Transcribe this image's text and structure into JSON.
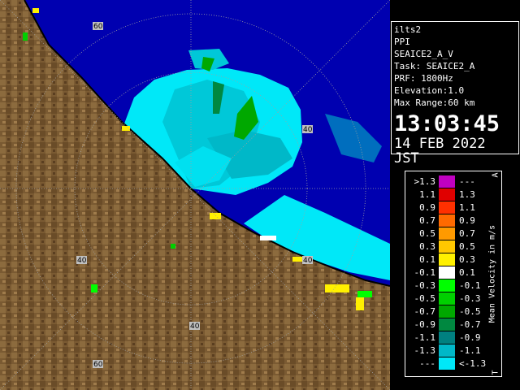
{
  "info": {
    "station": "ilts2",
    "product": "PPI",
    "volume": "SEAICE2_A_V",
    "task": "Task: SEAICE2_A",
    "prf": "PRF: 1800Hz",
    "elevation": "Elevation:1.0",
    "max_range": "Max Range:60 km",
    "time": "13:03:45",
    "date": "14 FEB 2022 JST"
  },
  "range_rings": {
    "labels": [
      "60",
      "40",
      "40",
      "40",
      "40",
      "60"
    ]
  },
  "legend": {
    "title": "Mean Velocity in m/s",
    "corner_top": "A",
    "corner_bottom": "T",
    "rows": [
      {
        "lo": ">1.3",
        "hi": "---",
        "color": "#c000c0"
      },
      {
        "lo": "1.1",
        "hi": "1.3",
        "color": "#e00000"
      },
      {
        "lo": "0.9",
        "hi": "1.1",
        "color": "#ff3000"
      },
      {
        "lo": "0.7",
        "hi": "0.9",
        "color": "#ff6a00"
      },
      {
        "lo": "0.5",
        "hi": "0.7",
        "color": "#ff9a00"
      },
      {
        "lo": "0.3",
        "hi": "0.5",
        "color": "#ffc800"
      },
      {
        "lo": "0.1",
        "hi": "0.3",
        "color": "#fff000"
      },
      {
        "lo": "-0.1",
        "hi": "0.1",
        "color": "#ffffff"
      },
      {
        "lo": "-0.3",
        "hi": "-0.1",
        "color": "#00ff00"
      },
      {
        "lo": "-0.5",
        "hi": "-0.3",
        "color": "#00d000"
      },
      {
        "lo": "-0.7",
        "hi": "-0.5",
        "color": "#00a800"
      },
      {
        "lo": "-0.9",
        "hi": "-0.7",
        "color": "#008840"
      },
      {
        "lo": "-1.1",
        "hi": "-0.9",
        "color": "#008080"
      },
      {
        "lo": "-1.3",
        "hi": "-1.1",
        "color": "#00b8c8"
      },
      {
        "lo": "---",
        "hi": "<-1.3",
        "color": "#00e8f8"
      }
    ]
  },
  "colors": {
    "sea": "#0000b0",
    "land": "#7a5a32",
    "echo_light": "#00e8f8",
    "echo_mid": "#00b8c8",
    "ring": "#b0b0b0"
  }
}
